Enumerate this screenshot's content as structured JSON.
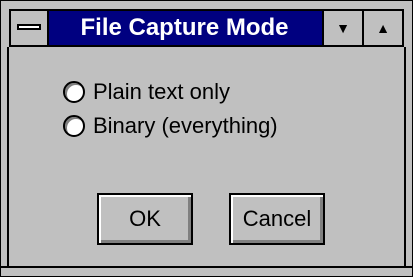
{
  "window": {
    "title": "File Capture Mode"
  },
  "icons": {
    "system_menu": "system-menu-icon",
    "minimize": "triangle-down-icon",
    "maximize": "triangle-up-icon"
  },
  "options": [
    {
      "label": "Plain text only",
      "selected": false
    },
    {
      "label": "Binary (everything)",
      "selected": false
    }
  ],
  "buttons": {
    "ok_label": "OK",
    "cancel_label": "Cancel"
  },
  "colors": {
    "title_bar": "#000080",
    "face": "#c0c0c0"
  }
}
